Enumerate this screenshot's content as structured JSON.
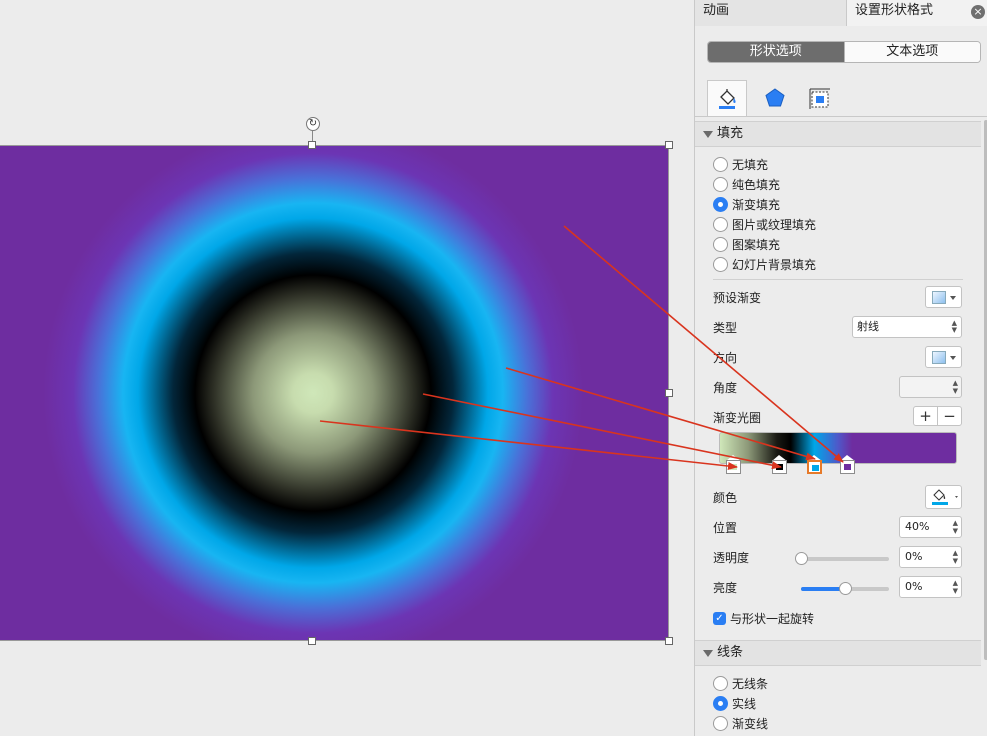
{
  "tabs": {
    "animation": "动画",
    "format_shape": "设置形状格式",
    "close": "×"
  },
  "segment": {
    "shape_options": "形状选项",
    "text_options": "文本选项"
  },
  "icons": {
    "fill_line": "paint-bucket-icon",
    "effects": "pentagon-icon",
    "size_properties": "size-layout-icon",
    "rotate": "rotate-icon"
  },
  "fill_section": {
    "title": "填充",
    "options": [
      {
        "label": "无填充",
        "selected": false
      },
      {
        "label": "纯色填充",
        "selected": false
      },
      {
        "label": "渐变填充",
        "selected": true
      },
      {
        "label": "图片或纹理填充",
        "selected": false
      },
      {
        "label": "图案填充",
        "selected": false
      },
      {
        "label": "幻灯片背景填充",
        "selected": false
      }
    ],
    "preset_gradient": "预设渐变",
    "type_label": "类型",
    "type_value": "射线",
    "direction": "方向",
    "angle": "角度",
    "angle_value": "",
    "gradient_stops": "渐变光圈",
    "add_stop": "+",
    "remove_stop": "−",
    "stops": [
      {
        "color": "#cfe7b9",
        "selected": false
      },
      {
        "color": "#000000",
        "selected": false
      },
      {
        "color": "#00a7e8",
        "selected": true
      },
      {
        "color": "#6e2da0",
        "selected": false
      }
    ],
    "color_label": "颜色",
    "color_value": "#00a7e8",
    "position_label": "位置",
    "position_value": "40%",
    "transparency_label": "透明度",
    "transparency_value": "0%",
    "transparency_level": 0,
    "brightness_label": "亮度",
    "brightness_value": "0%",
    "brightness_level": 0.5,
    "rotate_with_shape": "与形状一起旋转",
    "rotate_with_shape_checked": true,
    "check_mark": "✓"
  },
  "line_section": {
    "title": "线条",
    "options": [
      {
        "label": "无线条",
        "selected": false
      },
      {
        "label": "实线",
        "selected": true
      },
      {
        "label": "渐变线",
        "selected": false
      }
    ]
  },
  "colors": {
    "accent": "#2a7ef3",
    "arrow": "#d9341e",
    "purple": "#6e2da0",
    "cyan": "#00a7e8"
  }
}
